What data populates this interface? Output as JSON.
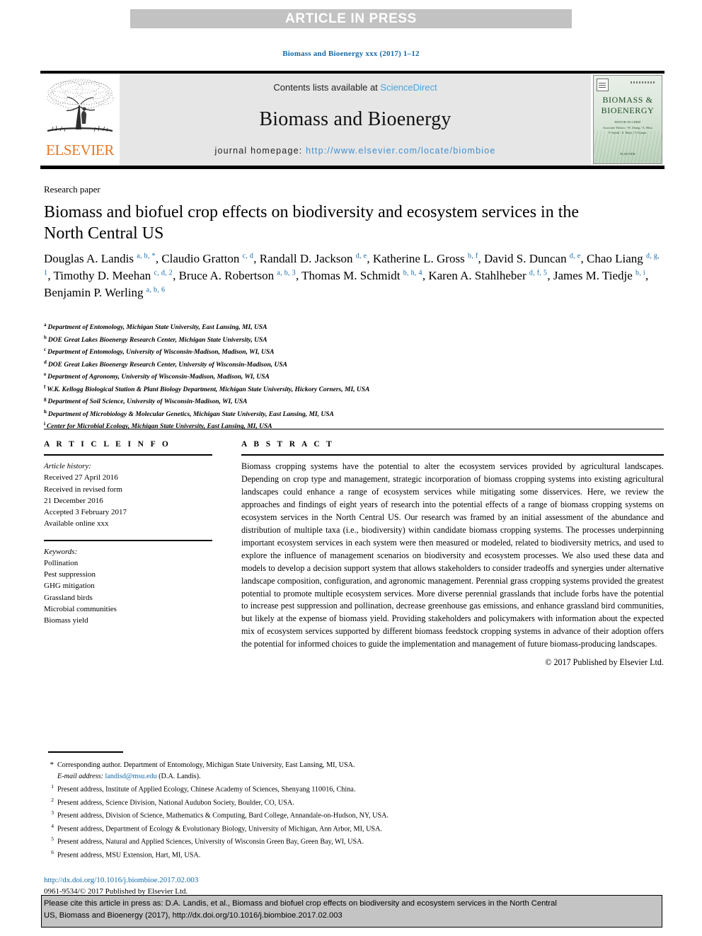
{
  "banner": {
    "text": "ARTICLE IN PRESS"
  },
  "running_head": "Biomass and Bioenergy xxx (2017) 1–12",
  "masthead": {
    "contents_prefix": "Contents lists available at ",
    "sciencedirect": "ScienceDirect",
    "journal_title": "Biomass and Bioenergy",
    "homepage_label": "journal homepage: ",
    "homepage_url": "http://www.elsevier.com/locate/biombioe",
    "publisher_logo_text": "ELSEVIER",
    "cover": {
      "title_line1": "BIOMASS &",
      "title_line2": "BIOENERGY",
      "subtitle_line1": "EDITOR-IN-CHIEF",
      "subtitle_line2": "Associate Editors / W. Zhang / A. Bliss",
      "subtitle_line3": "P. Smith / S. Mani / V. Kumar",
      "footer": "ELSEVIER"
    },
    "colors": {
      "elsevier_orange": "#e87722",
      "link_blue": "#4ba3dd",
      "panel_gray": "#e6e6e6",
      "banner_gray": "#c2c2c2"
    }
  },
  "article": {
    "type": "Research paper",
    "title": "Biomass and biofuel crop effects on biodiversity and ecosystem services in the North Central US",
    "authors": [
      {
        "name": "Douglas A. Landis",
        "sup": "a, b, *",
        "sep": ", "
      },
      {
        "name": "Claudio Gratton",
        "sup": "c, d",
        "sep": ", "
      },
      {
        "name": "Randall D. Jackson",
        "sup": "d, e",
        "sep": ", "
      },
      {
        "name": "Katherine L. Gross",
        "sup": "b, f",
        "sep": ", "
      },
      {
        "name": "David S. Duncan",
        "sup": "d, e",
        "sep": ", "
      },
      {
        "name": "Chao Liang",
        "sup": "d, g, 1",
        "sep": ", "
      },
      {
        "name": "Timothy D. Meehan",
        "sup": "c, d, 2",
        "sep": ", "
      },
      {
        "name": "Bruce A. Robertson",
        "sup": "a, b, 3",
        "sep": ", "
      },
      {
        "name": "Thomas M. Schmidt",
        "sup": "b, h, 4",
        "sep": ", "
      },
      {
        "name": "Karen A. Stahlheber",
        "sup": "d, f, 5",
        "sep": ", "
      },
      {
        "name": "James M. Tiedje",
        "sup": "b, i",
        "sep": ", "
      },
      {
        "name": "Benjamin P. Werling",
        "sup": "a, b, 6",
        "sep": ""
      }
    ],
    "affiliations": [
      {
        "marker": "a",
        "text": "Department of Entomology, Michigan State University, East Lansing, MI, USA"
      },
      {
        "marker": "b",
        "text": "DOE Great Lakes Bioenergy Research Center, Michigan State University, USA"
      },
      {
        "marker": "c",
        "text": "Department of Entomology, University of Wisconsin-Madison, Madison, WI, USA"
      },
      {
        "marker": "d",
        "text": "DOE Great Lakes Bioenergy Research Center, University of Wisconsin-Madison, USA"
      },
      {
        "marker": "e",
        "text": "Department of Agronomy, University of Wisconsin-Madison, Madison, WI, USA"
      },
      {
        "marker": "f",
        "text": "W.K. Kellogg Biological Station & Plant Biology Department, Michigan State University, Hickory Corners, MI, USA"
      },
      {
        "marker": "g",
        "text": "Department of Soil Science, University of Wisconsin-Madison, WI, USA"
      },
      {
        "marker": "h",
        "text": "Department of Microbiology & Molecular Genetics, Michigan State University, East Lansing, MI, USA"
      },
      {
        "marker": "i",
        "text": "Center for Microbial Ecology, Michigan State University, East Lansing, MI, USA"
      }
    ]
  },
  "article_info": {
    "heading": "A R T I C L E   I N F O",
    "history_label": "Article history:",
    "history": [
      "Received 27 April 2016",
      "Received in revised form",
      "21 December 2016",
      "Accepted 3 February 2017",
      "Available online xxx"
    ],
    "keywords_label": "Keywords:",
    "keywords": [
      "Pollination",
      "Pest suppression",
      "GHG mitigation",
      "Grassland birds",
      "Microbial communities",
      "Biomass yield"
    ]
  },
  "abstract": {
    "heading": "A B S T R A C T",
    "body": "Biomass cropping systems have the potential to alter the ecosystem services provided by agricultural landscapes. Depending on crop type and management, strategic incorporation of biomass cropping systems into existing agricultural landscapes could enhance a range of ecosystem services while mitigating some disservices. Here, we review the approaches and findings of eight years of research into the potential effects of a range of biomass cropping systems on ecosystem services in the North Central US. Our research was framed by an initial assessment of the abundance and distribution of multiple taxa (i.e., biodiversity) within candidate biomass cropping systems. The processes underpinning important ecosystem services in each system were then measured or modeled, related to biodiversity metrics, and used to explore the influence of management scenarios on biodiversity and ecosystem processes. We also used these data and models to develop a decision support system that allows stakeholders to consider tradeoffs and synergies under alternative landscape composition, configuration, and agronomic management. Perennial grass cropping systems provided the greatest potential to promote multiple ecosystem services. More diverse perennial grasslands that include forbs have the potential to increase pest suppression and pollination, decrease greenhouse gas emissions, and enhance grassland bird communities, but likely at the expense of biomass yield. Providing stakeholders and policymakers with information about the expected mix of ecosystem services supported by different biomass feedstock cropping systems in advance of their adoption offers the potential for informed choices to guide the implementation and management of future biomass-producing landscapes.",
    "copyright": "© 2017 Published by Elsevier Ltd."
  },
  "footnotes": {
    "corresponding": {
      "marker": "*",
      "text": "Corresponding author. Department of Entomology, Michigan State University, East Lansing, MI, USA.",
      "email_label": "E-mail address:",
      "email": "landisd@msu.edu",
      "email_suffix": "(D.A. Landis)."
    },
    "present_addresses": [
      {
        "marker": "1",
        "text": "Present address, Institute of Applied Ecology, Chinese Academy of Sciences, Shenyang 110016, China."
      },
      {
        "marker": "2",
        "text": "Present address, Science Division, National Audubon Society, Boulder, CO, USA."
      },
      {
        "marker": "3",
        "text": "Present address, Division of Science, Mathematics & Computing, Bard College, Annandale-on-Hudson, NY, USA."
      },
      {
        "marker": "4",
        "text": "Present address, Department of Ecology & Evolutionary Biology, University of Michigan, Ann Arbor, MI, USA."
      },
      {
        "marker": "5",
        "text": "Present address, Natural and Applied Sciences, University of Wisconsin Green Bay, Green Bay, WI, USA."
      },
      {
        "marker": "6",
        "text": "Present address, MSU Extension, Hart, MI, USA."
      }
    ],
    "doi": "http://dx.doi.org/10.1016/j.biombioe.2017.02.003",
    "issn_line": "0961-9534/© 2017 Published by Elsevier Ltd."
  },
  "citation_box": {
    "line1": "Please cite this article in press as: D.A. Landis, et al., Biomass and biofuel crop effects on biodiversity and ecosystem services in the North Central",
    "line2": "US, Biomass and Bioenergy (2017), http://dx.doi.org/10.1016/j.biombioe.2017.02.003"
  }
}
